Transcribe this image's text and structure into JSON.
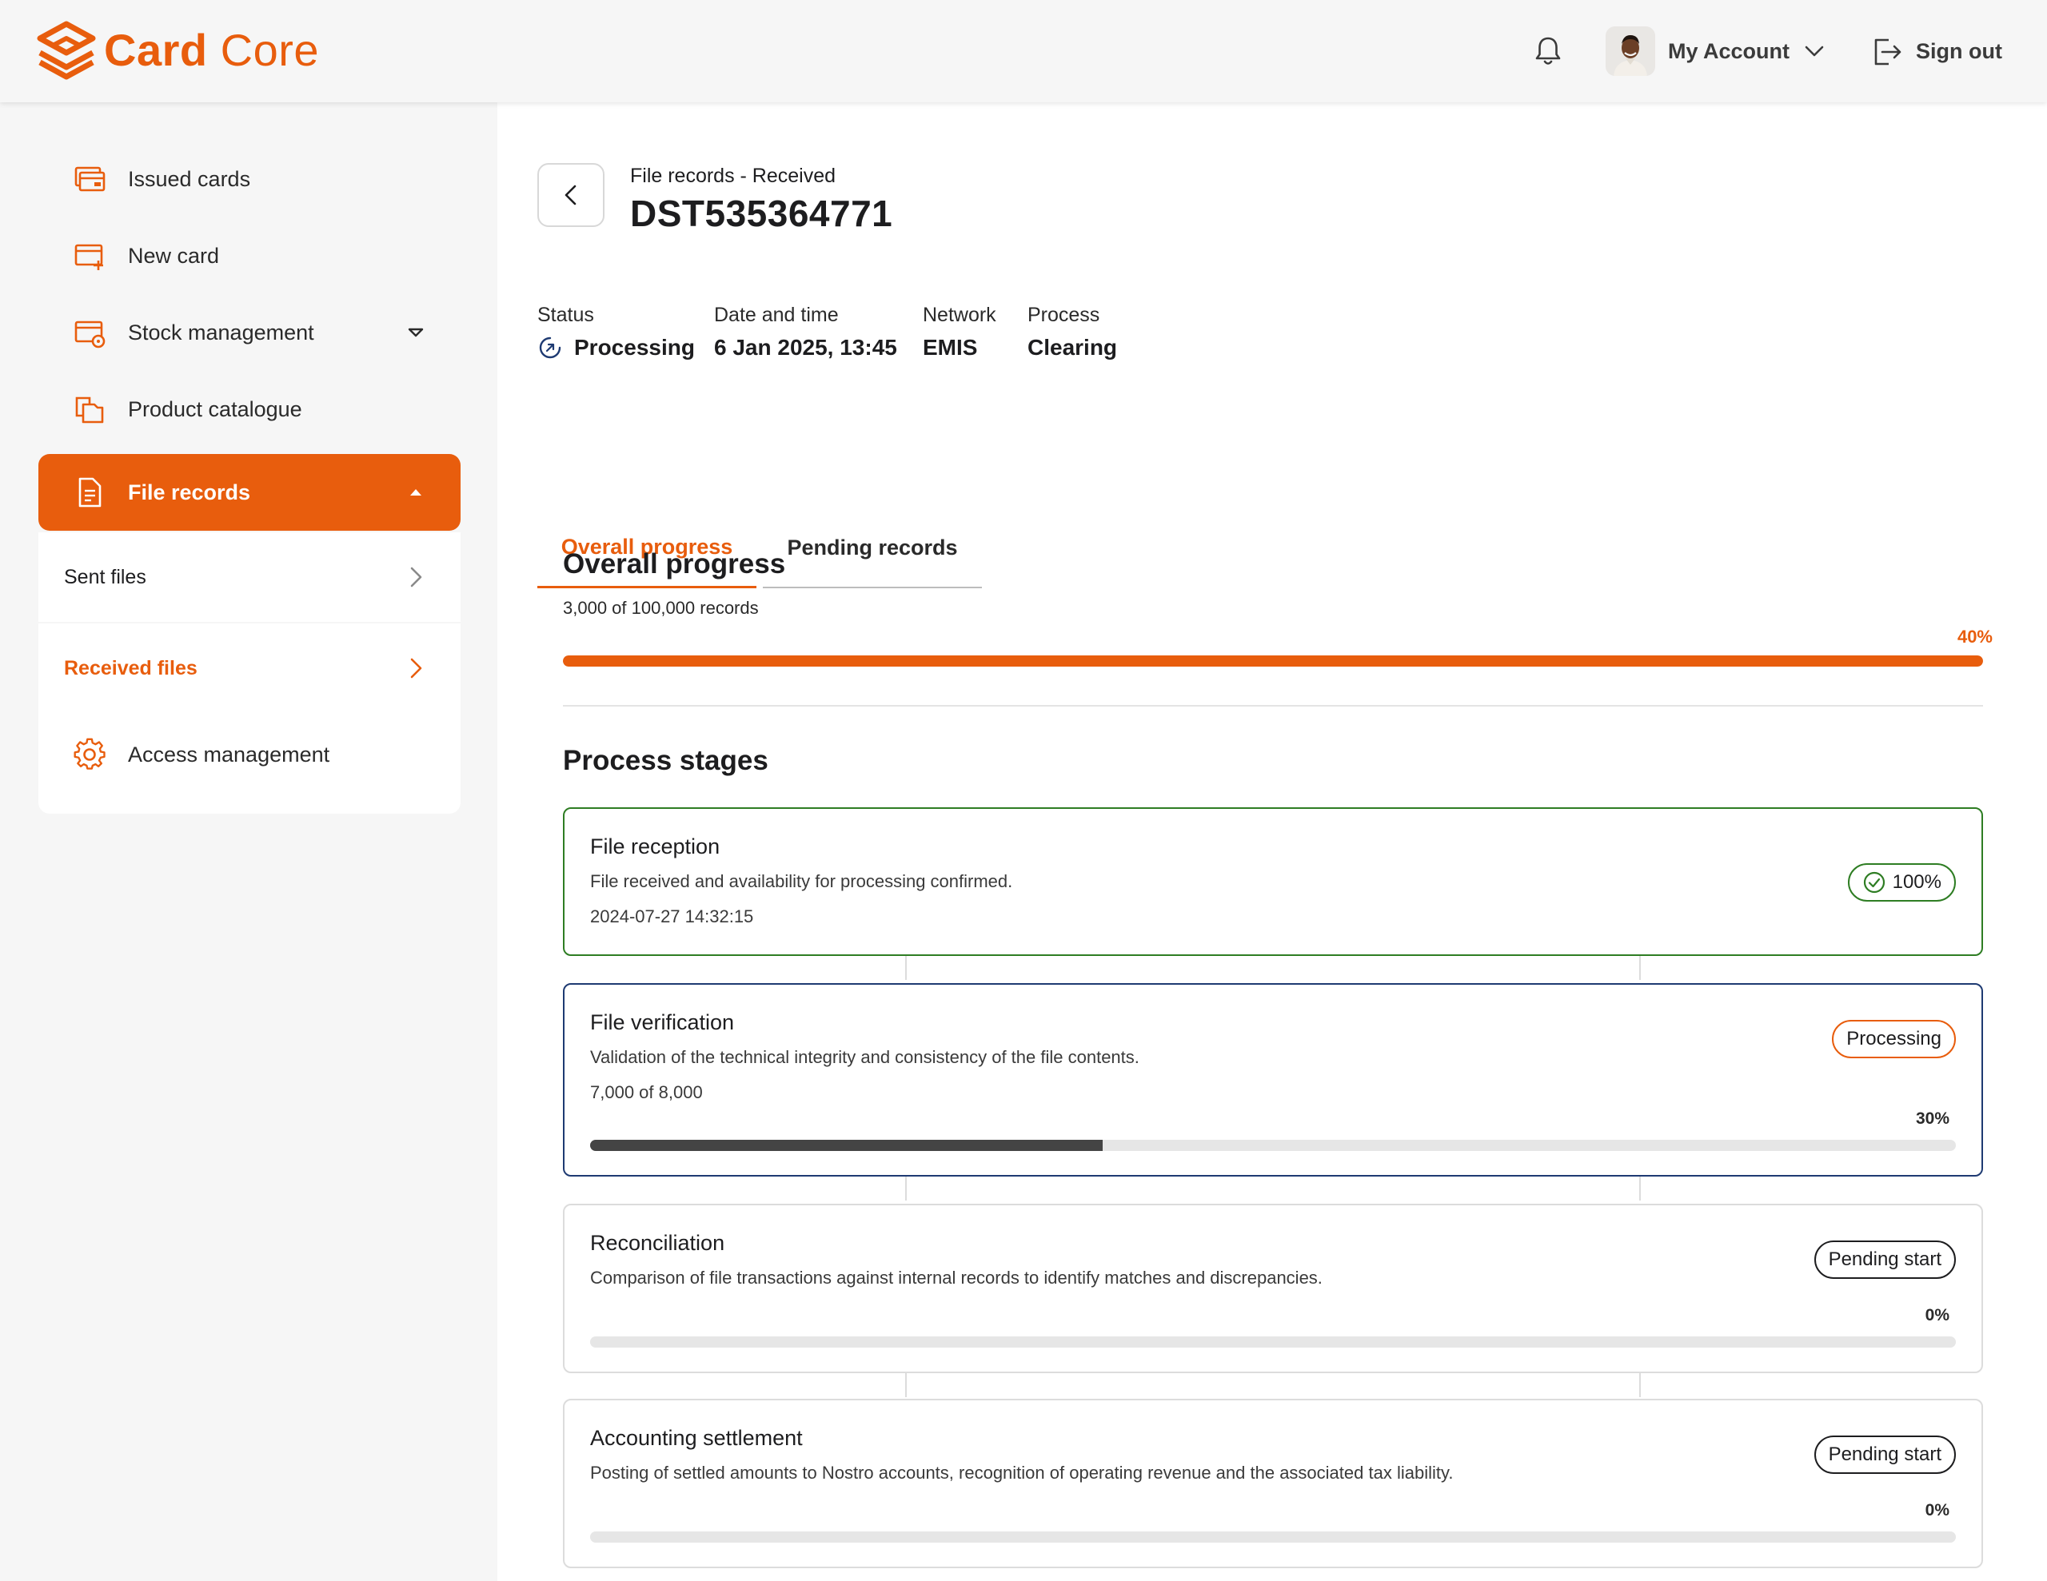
{
  "brand": {
    "name_part1": "Card",
    "name_part2": "Core",
    "color": "#e85d0d"
  },
  "header": {
    "notifications_icon": "bell-icon",
    "account_label": "My Account",
    "signout_label": "Sign out"
  },
  "sidebar": {
    "items": [
      {
        "label": "Issued cards",
        "icon": "cards-icon"
      },
      {
        "label": "New card",
        "icon": "new-card-icon"
      },
      {
        "label": "Stock management",
        "icon": "stock-icon"
      },
      {
        "label": "Product catalogue",
        "icon": "catalogue-icon"
      },
      {
        "label": "File records",
        "icon": "file-icon",
        "active": true
      },
      {
        "label": "Access management",
        "icon": "gear-icon"
      }
    ],
    "sub_items": [
      {
        "label": "Sent files"
      },
      {
        "label": "Received files",
        "selected": true
      }
    ]
  },
  "page": {
    "breadcrumb": "File records - Received",
    "title": "DST535364771",
    "meta": {
      "status_label": "Status",
      "status_value": "Processing",
      "date_label": "Date and time",
      "date_value": "6 Jan 2025, 13:45",
      "network_label": "Network",
      "network_value": "EMIS",
      "process_label": "Process",
      "process_value": "Clearing"
    },
    "tabs": [
      {
        "label": "Overall progress",
        "active": true
      },
      {
        "label": "Pending records",
        "active": false
      }
    ],
    "overall": {
      "title": "Overall progress",
      "records_text": "3,000 of 100,000 records",
      "percent_text": "40%",
      "fill_fraction": 1.0
    },
    "stages_title": "Process stages",
    "stages": [
      {
        "title": "File reception",
        "description": "File received and availability for processing confirmed.",
        "extra": "2024-07-27 14:32:15",
        "badge": "100%",
        "state": "done"
      },
      {
        "title": "File verification",
        "description": "Validation of the technical integrity and consistency of the file contents.",
        "extra": "7,000 of 8,000",
        "badge": "Processing",
        "percent_text": "30%",
        "fill_fraction": 0.375,
        "state": "processing"
      },
      {
        "title": "Reconciliation",
        "description": "Comparison of file transactions against internal records to identify matches and discrepancies.",
        "badge": "Pending start",
        "percent_text": "0%",
        "fill_fraction": 0,
        "state": "pending"
      },
      {
        "title": "Accounting settlement",
        "description": "Posting of settled amounts to Nostro accounts, recognition of operating revenue and the associated tax liability.",
        "badge": "Pending start",
        "percent_text": "0%",
        "fill_fraction": 0,
        "state": "pending"
      }
    ]
  }
}
